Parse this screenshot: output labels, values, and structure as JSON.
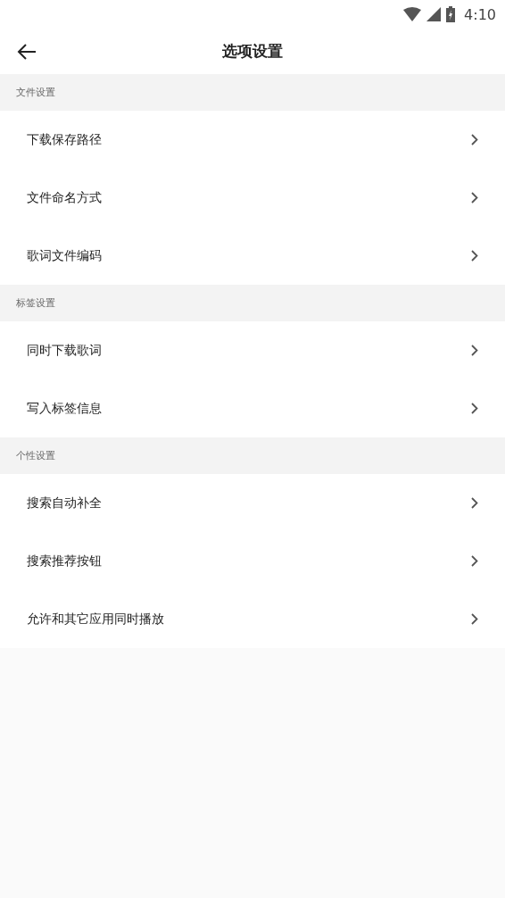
{
  "status_bar": {
    "time": "4:10"
  },
  "header": {
    "title": "选项设置"
  },
  "sections": [
    {
      "title": "文件设置",
      "items": [
        {
          "label": "下载保存路径"
        },
        {
          "label": "文件命名方式"
        },
        {
          "label": "歌词文件编码"
        }
      ]
    },
    {
      "title": "标签设置",
      "items": [
        {
          "label": "同时下载歌词"
        },
        {
          "label": "写入标签信息"
        }
      ]
    },
    {
      "title": "个性设置",
      "items": [
        {
          "label": "搜索自动补全"
        },
        {
          "label": "搜索推荐按钮"
        },
        {
          "label": "允许和其它应用同时播放"
        }
      ]
    }
  ]
}
